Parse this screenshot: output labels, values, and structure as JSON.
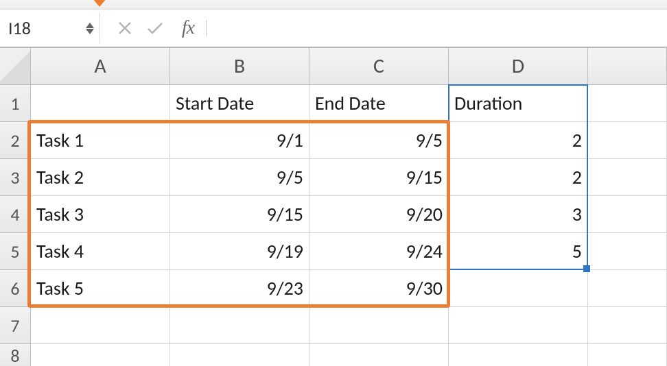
{
  "name_box": {
    "cell_ref": "I18"
  },
  "formula_bar": {
    "fx_label": "fx",
    "formula_value": ""
  },
  "columns": [
    "A",
    "B",
    "C",
    "D"
  ],
  "headers": {
    "A": "",
    "B": "Start Date",
    "C": "End Date",
    "D": "Duration"
  },
  "rows": [
    {
      "num": 2,
      "A": "Task 1",
      "B": "9/1",
      "C": "9/5",
      "D": "2"
    },
    {
      "num": 3,
      "A": "Task 2",
      "B": "9/5",
      "C": "9/15",
      "D": "2"
    },
    {
      "num": 4,
      "A": "Task 3",
      "B": "9/15",
      "C": "9/20",
      "D": "3"
    },
    {
      "num": 5,
      "A": "Task 4",
      "B": "9/19",
      "C": "9/24",
      "D": "5"
    },
    {
      "num": 6,
      "A": "Task 5",
      "B": "9/23",
      "C": "9/30",
      "D": ""
    }
  ],
  "visible_row_nums": [
    1,
    2,
    3,
    4,
    5,
    6,
    7,
    8
  ],
  "orange_highlight_range": "A2:C6",
  "blue_selection_range": "D1:D5",
  "colors": {
    "accent_orange": "#ed7d31",
    "selection_blue": "#2e75c6"
  },
  "chart_data": {
    "type": "table",
    "columns": [
      "",
      "Start Date",
      "End Date",
      "Duration"
    ],
    "rows": [
      [
        "Task 1",
        "9/1",
        "9/5",
        2
      ],
      [
        "Task 2",
        "9/5",
        "9/15",
        2
      ],
      [
        "Task 3",
        "9/15",
        "9/20",
        3
      ],
      [
        "Task 4",
        "9/19",
        "9/24",
        5
      ],
      [
        "Task 5",
        "9/23",
        "9/30",
        null
      ]
    ]
  }
}
